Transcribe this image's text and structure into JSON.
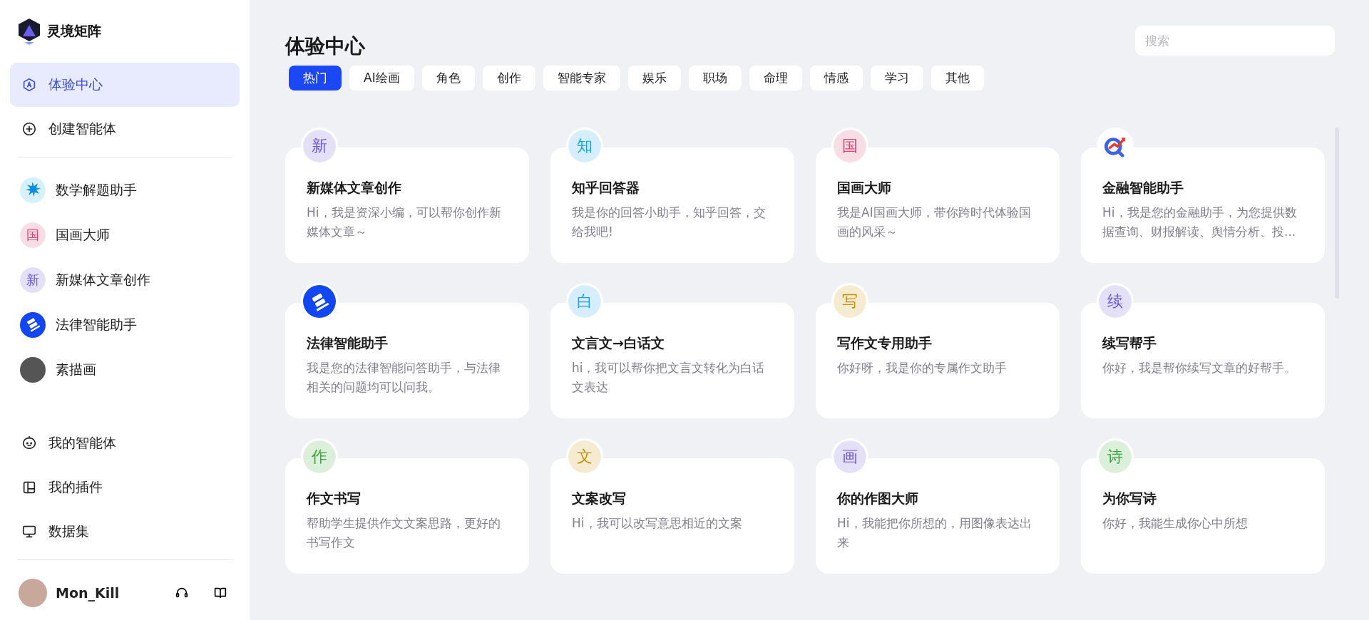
{
  "brand": {
    "name": "灵境矩阵"
  },
  "nav": [
    {
      "label": "体验中心",
      "selected": true
    },
    {
      "label": "创建智能体",
      "selected": false
    }
  ],
  "recent": [
    {
      "label": "数学解题助手",
      "kind": "starburst"
    },
    {
      "label": "国画大师",
      "kind": "char",
      "char": "国",
      "color": "#e0406f"
    },
    {
      "label": "新媒体文章创作",
      "kind": "char",
      "char": "新",
      "color": "#6a55d8"
    },
    {
      "label": "法律智能助手",
      "kind": "gavel"
    },
    {
      "label": "素描画",
      "kind": "photo"
    }
  ],
  "tools": [
    {
      "label": "我的智能体"
    },
    {
      "label": "我的插件"
    },
    {
      "label": "数据集"
    }
  ],
  "user": {
    "name": "Mon_Kill"
  },
  "page": {
    "title": "体验中心"
  },
  "search": {
    "placeholder": "搜索"
  },
  "tabs": [
    {
      "label": "热门",
      "selected": true
    },
    {
      "label": "AI绘画",
      "selected": false
    },
    {
      "label": "角色",
      "selected": false
    },
    {
      "label": "创作",
      "selected": false
    },
    {
      "label": "智能专家",
      "selected": false
    },
    {
      "label": "娱乐",
      "selected": false
    },
    {
      "label": "职场",
      "selected": false
    },
    {
      "label": "命理",
      "selected": false
    },
    {
      "label": "情感",
      "selected": false
    },
    {
      "label": "学习",
      "selected": false
    },
    {
      "label": "其他",
      "selected": false
    }
  ],
  "cards": [
    {
      "title": "新媒体文章创作",
      "desc": "Hi，我是资深小编，可以帮你创作新媒体文章～",
      "kind": "char",
      "char": "新",
      "color": "#6a55d8"
    },
    {
      "title": "知乎回答器",
      "desc": "我是你的回答小助手，知乎回答，交给我吧!",
      "kind": "char",
      "char": "知",
      "color": "#1aa0f0"
    },
    {
      "title": "国画大师",
      "desc": "我是AI国画大师，带你跨时代体验国画的风采～",
      "kind": "char",
      "char": "国",
      "color": "#e0406f"
    },
    {
      "title": "金融智能助手",
      "desc": "Hi，我是您的金融助手，为您提供数据查询、财报解读、舆情分析、投...",
      "kind": "finance"
    },
    {
      "title": "法律智能助手",
      "desc": "我是您的法律智能问答助手，与法律相关的问题均可以问我。",
      "kind": "gavel"
    },
    {
      "title": "文言文→白话文",
      "desc": "hi，我可以帮你把文言文转化为白话文表达",
      "kind": "char",
      "char": "白",
      "color": "#1aa0f0"
    },
    {
      "title": "写作文专用助手",
      "desc": "你好呀，我是你的专属作文助手",
      "kind": "char",
      "char": "写",
      "color": "#c09000"
    },
    {
      "title": "续写帮手",
      "desc": "你好，我是帮你续写文章的好帮手。",
      "kind": "char",
      "char": "续",
      "color": "#6a55d8"
    },
    {
      "title": "作文书写",
      "desc": "帮助学生提供作文文案思路，更好的书写作文",
      "kind": "char",
      "char": "作",
      "color": "#3aa53a"
    },
    {
      "title": "文案改写",
      "desc": "Hi，我可以改写意思相近的文案",
      "kind": "char",
      "char": "文",
      "color": "#c09000"
    },
    {
      "title": "你的作图大师",
      "desc": "Hi，我能把你所想的，用图像表达出来",
      "kind": "char",
      "char": "画",
      "color": "#6a55d8"
    },
    {
      "title": "为你写诗",
      "desc": "你好，我能生成你心中所想",
      "kind": "char",
      "char": "诗",
      "color": "#3aa53a"
    }
  ]
}
